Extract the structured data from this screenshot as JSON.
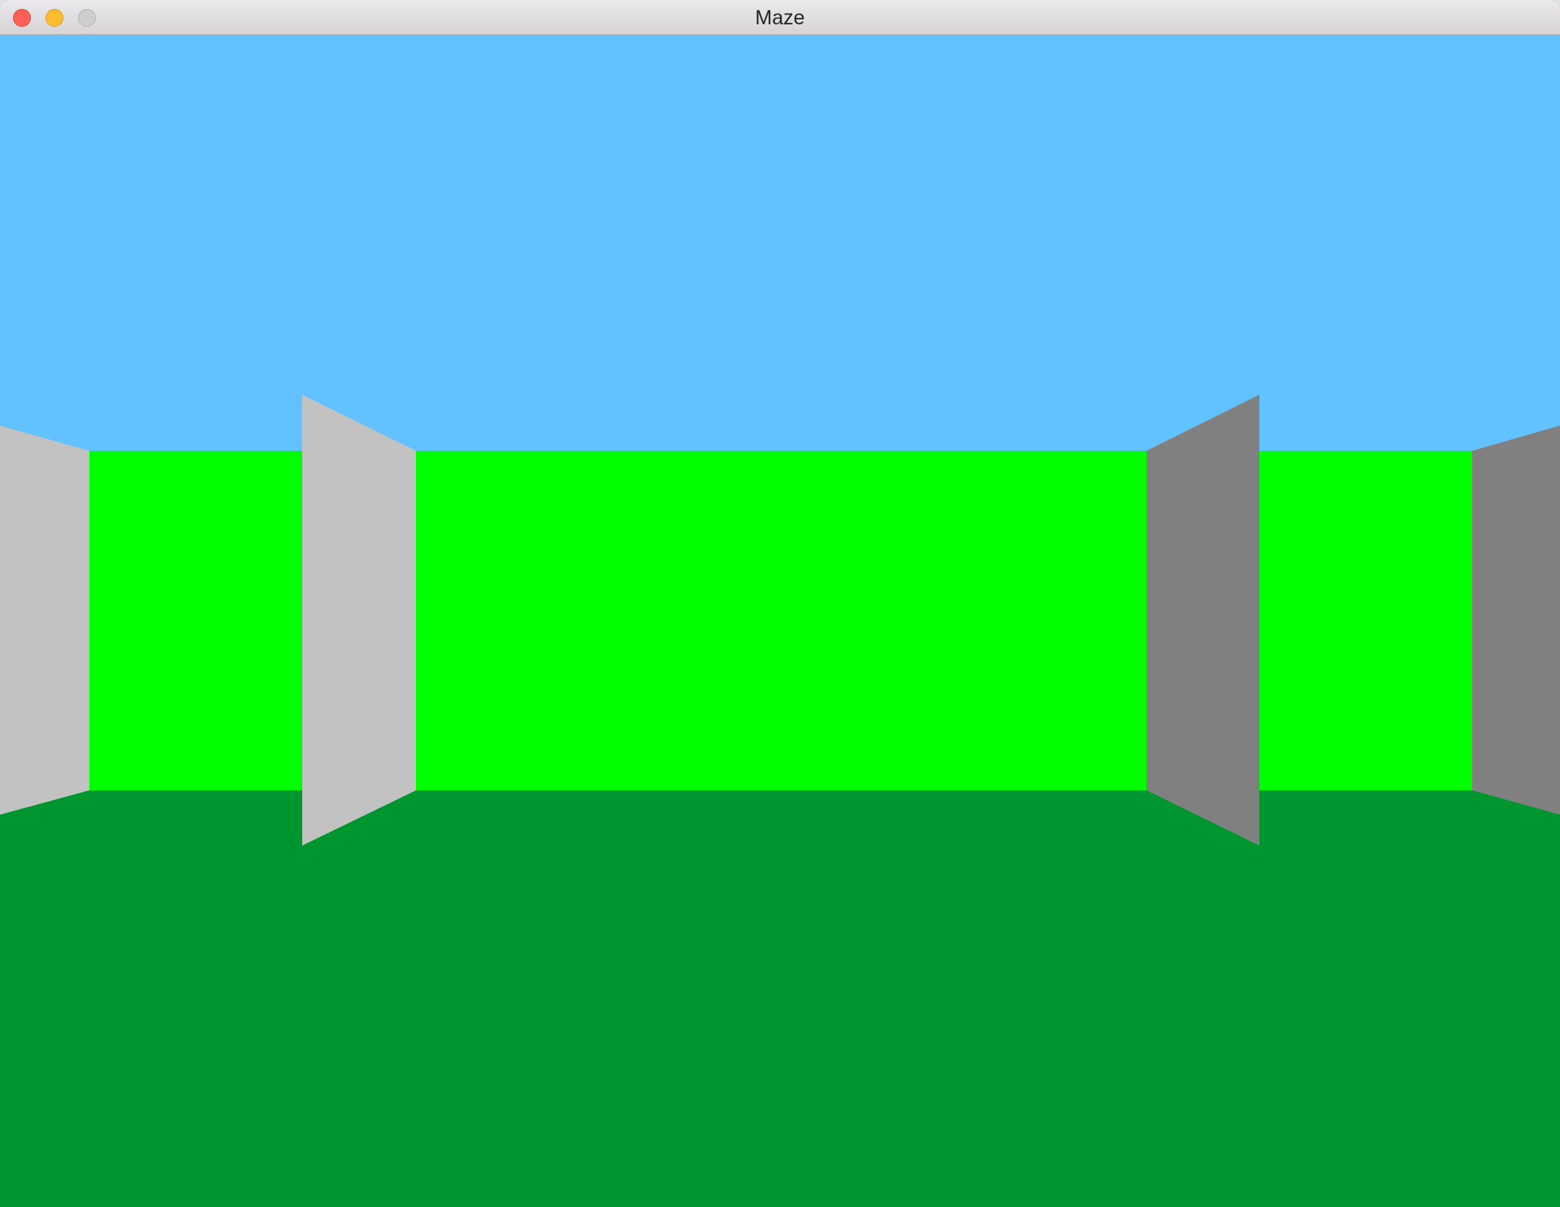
{
  "window": {
    "title": "Maze"
  },
  "scene": {
    "colors": {
      "sky": "#62c1ff",
      "floor": "#00962f",
      "far_wall": "#00ff00",
      "lit_side_wall": "#c2c2c2",
      "shaded_side_wall": "#808080"
    }
  }
}
